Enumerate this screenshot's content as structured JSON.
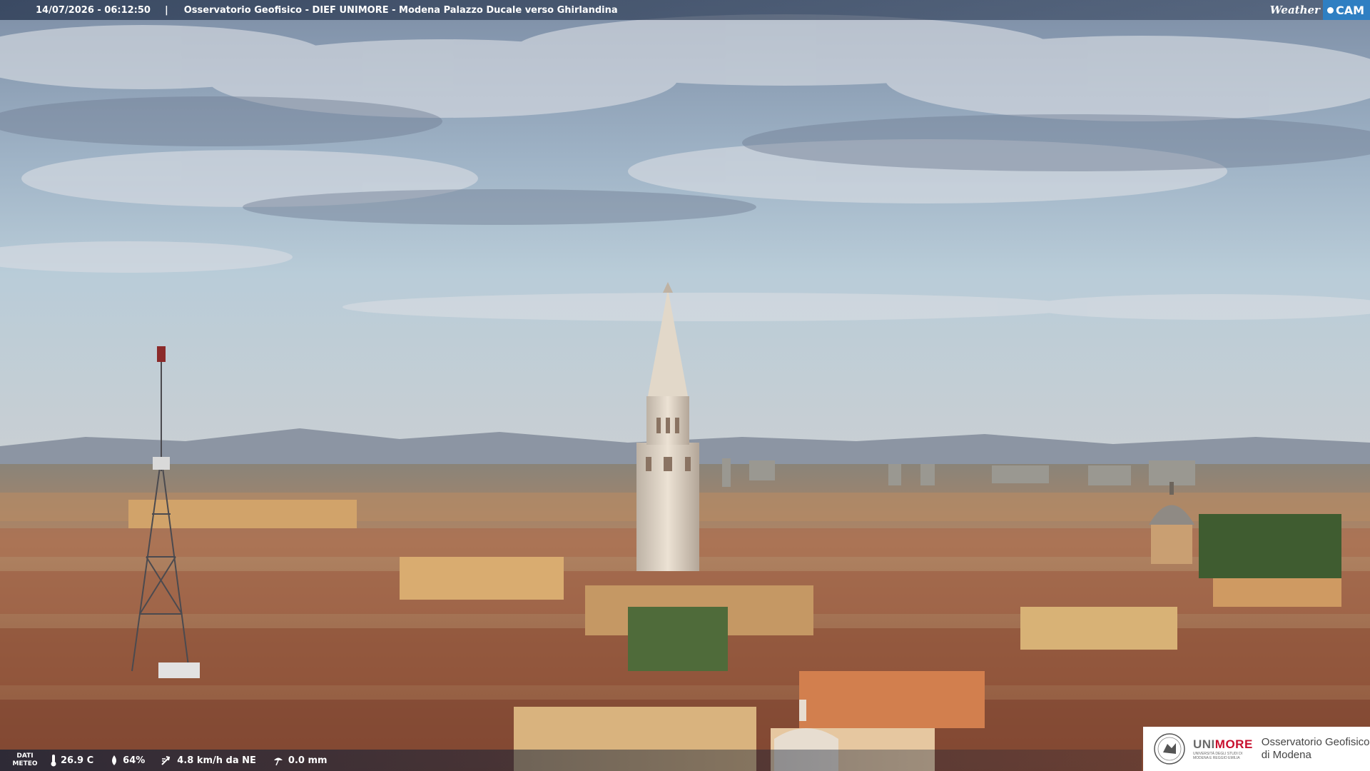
{
  "overlay": {
    "timestamp": "14/07/2026 - 06:12:50",
    "separator": "|",
    "location": "Osservatorio Geofisico - DIEF UNIMORE - Modena Palazzo Ducale verso Ghirlandina",
    "brand_weather": "Weather",
    "brand_cam": "CAM",
    "brand_color": "#2f7fc2"
  },
  "weather": {
    "dati_line1": "DATI",
    "dati_line2": "METEO",
    "temperature": "26.9 C",
    "humidity": "64%",
    "wind": "4.8 km/h da NE",
    "rain": "0.0 mm",
    "icons": [
      "thermometer-icon",
      "humidity-drop-icon",
      "wind-icon",
      "rain-icon"
    ]
  },
  "logo": {
    "name_part1": "UNI",
    "name_part2": "MORE",
    "name_subtext_line1": "UNIVERSITÀ DEGLI STUDI DI",
    "name_subtext_line2": "MODENA E REGGIO EMILIA",
    "obs_line1": "Osservatorio Geofisico",
    "obs_line2": "di Modena",
    "accent_color": "#c8102e"
  },
  "scene": {
    "description_subjects": [
      "sky",
      "clouds",
      "mountains",
      "city-roofs",
      "ghirlandina-tower",
      "antenna-tower",
      "dome"
    ],
    "sky_color": "#a9c0d3",
    "roof_color": "#b06a48"
  }
}
